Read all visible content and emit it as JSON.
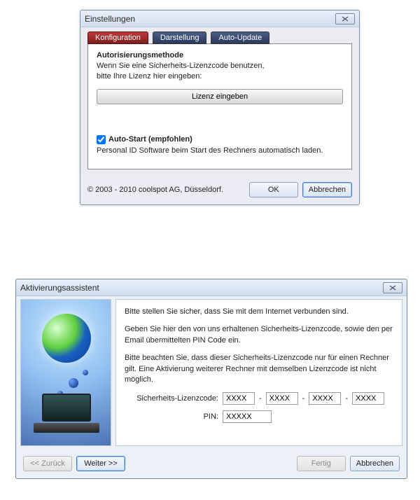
{
  "dialog1": {
    "title": "Einstellungen",
    "tabs": {
      "konfiguration": "Konfiguration",
      "darstellung": "Darstellung",
      "autoupdate": "Auto-Update"
    },
    "auth_heading": "Autorisierungsmethode",
    "auth_line1": "Wenn Sie eine Sicherheits-Lizenzcode benutzen,",
    "auth_line2": "bitte Ihre Lizenz hier eingeben:",
    "lizenz_button": "Lizenz eingeben",
    "autostart_label": "Auto-Start (empfohlen)",
    "autostart_hint": "Personal ID Software beim Start des Rechners automatisch laden.",
    "copyright": "© 2003 - 2010 coolspot AG, Düsseldorf.",
    "ok": "OK",
    "cancel": "Abbrechen"
  },
  "dialog2": {
    "title": "Aktivierungsassistent",
    "p1": "Bitte stellen Sie sicher, dass Sie mit dem Internet verbunden sind.",
    "p2": "Geben Sie hier den von uns erhaltenen Sicherheits-Lizenzcode, sowie den per Email übermittelten PIN Code ein.",
    "p3": "Bitte beachten Sie, dass dieser Sicherheits-Lizenzcode nur für einen Rechner gilt. Eine Aktivierung weiterer Rechner mit demselben Lizenzcode ist nicht möglich.",
    "code_label": "Sicherheits-Lizenzcode:",
    "pin_label": "PIN:",
    "code_parts": [
      "XXXX",
      "XXXX",
      "XXXX",
      "XXXX"
    ],
    "pin_value": "XXXXX",
    "back": "<< Zurück",
    "next": "Weiter >>",
    "finish": "Fertig",
    "cancel": "Abbrechen"
  }
}
